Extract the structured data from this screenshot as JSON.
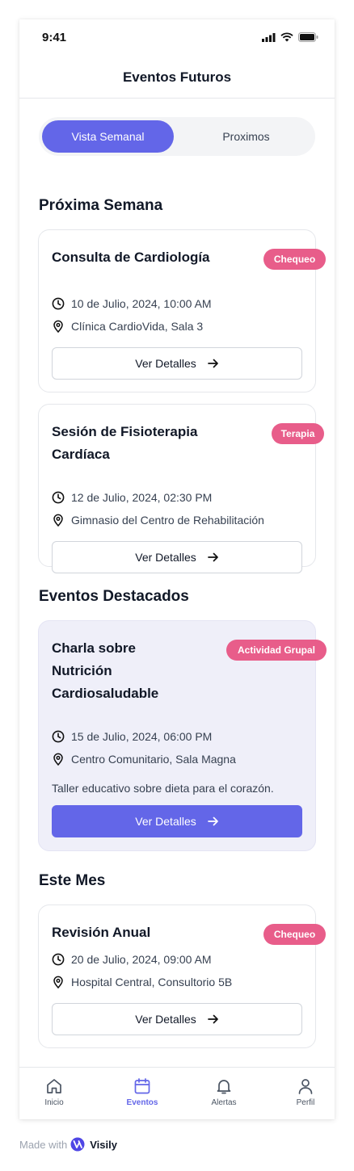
{
  "status_bar": {
    "time": "9:41"
  },
  "header": {
    "title": "Eventos Futuros"
  },
  "segments": {
    "active": "Vista Semanal",
    "inactive": "Proximos"
  },
  "sections": {
    "next_week": "Próxima Semana",
    "featured": "Eventos Destacados",
    "this_month": "Este Mes"
  },
  "events": [
    {
      "title": "Consulta de Cardiología",
      "badge": "Chequeo",
      "date": "10 de Julio, 2024, 10:00 AM",
      "location": "Clínica CardioVida, Sala 3",
      "button": "Ver Detalles"
    },
    {
      "title_line1": "Sesión de Fisioterapia",
      "title_line2": "Cardíaca",
      "badge": "Terapia",
      "date": "12 de Julio, 2024, 02:30 PM",
      "location": "Gimnasio del Centro de Rehabilitación",
      "button": "Ver Detalles"
    },
    {
      "title_line1": "Charla sobre",
      "title_line2": "Nutrición",
      "title_line3": "Cardiosaludable",
      "badge": "Actividad Grupal",
      "date": "15 de Julio, 2024, 06:00 PM",
      "location": "Centro Comunitario, Sala Magna",
      "description": "Taller educativo sobre dieta para el corazón.",
      "button": "Ver Detalles"
    },
    {
      "title": "Revisión Anual",
      "badge": "Chequeo",
      "date": "20 de Julio, 2024, 09:00 AM",
      "location": "Hospital Central, Consultorio 5B",
      "button": "Ver Detalles"
    }
  ],
  "tabbar": {
    "home": "Inicio",
    "events": "Eventos",
    "alerts": "Alertas",
    "profile": "Perfil"
  },
  "footer": {
    "made_with": "Made with",
    "brand": "Visily"
  },
  "colors": {
    "accent": "#6366e8",
    "badge": "#e85d8a",
    "featured_bg": "#efeff9"
  }
}
